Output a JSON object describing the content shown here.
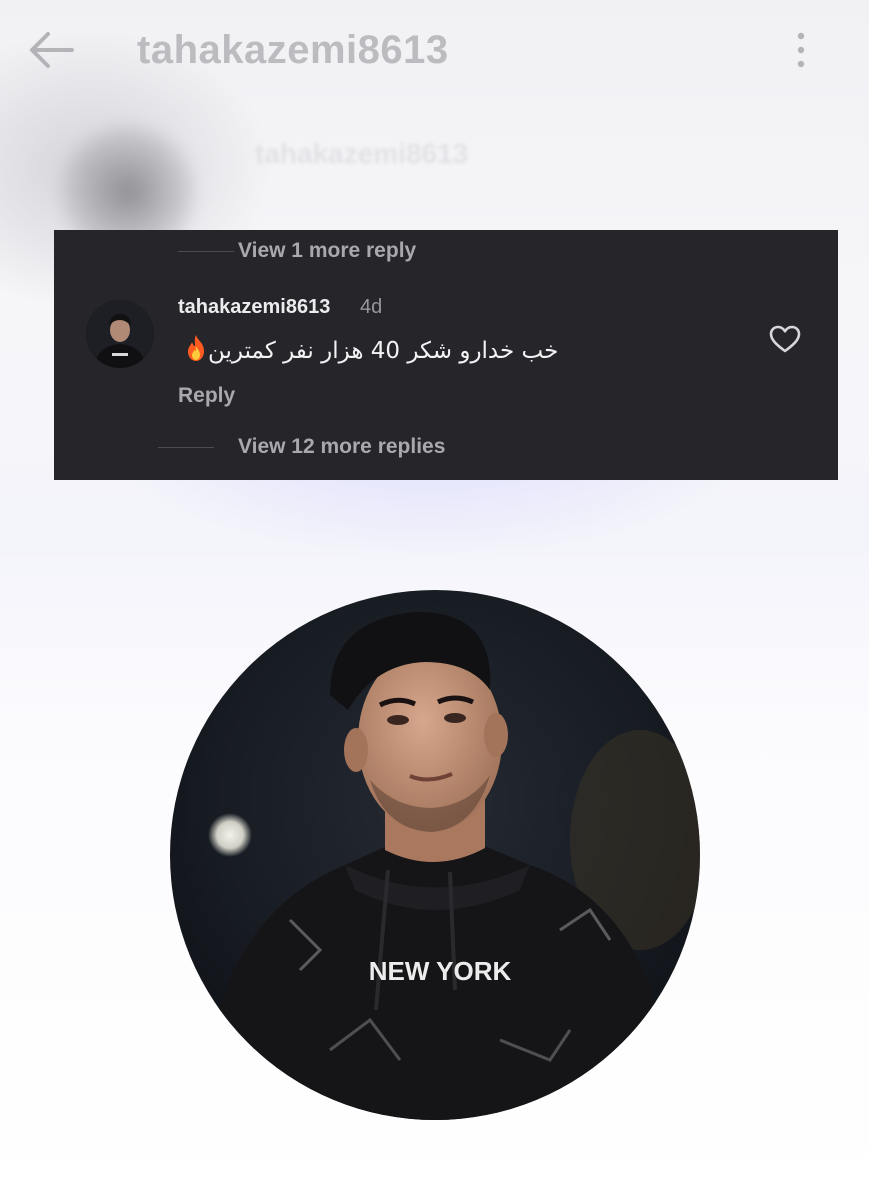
{
  "header": {
    "title": "tahakazemi8613",
    "back_icon": "arrow-left-icon",
    "more_icon": "vertical-dots-icon"
  },
  "blurred_profile": {
    "name": "tahakazemi8613"
  },
  "comment_section": {
    "view_more_top": "View 1 more reply",
    "comment": {
      "username": "tahakazemi8613",
      "time": "4d",
      "text": "خب خدارو شکر 40 هزار نفر کمترین",
      "emoji_icon": "fire-icon",
      "reply_label": "Reply",
      "like_icon": "heart-outline-icon"
    },
    "view_more_bottom": "View 12 more replies"
  },
  "profile_photo": {
    "shirt_text": "NEW YORK"
  },
  "colors": {
    "card_background": "#25252a",
    "secondary_text": "#a8a8ae",
    "header_text": "#bcbcc0"
  }
}
